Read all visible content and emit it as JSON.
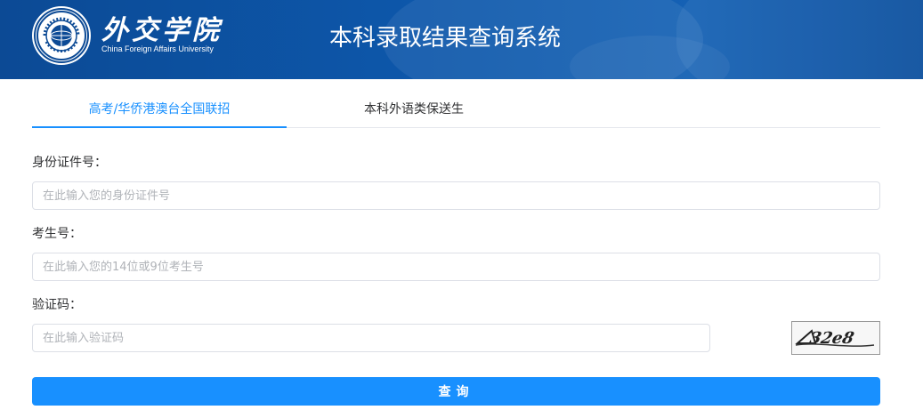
{
  "header": {
    "logo_cn": "外交学院",
    "logo_en": "China Foreign Affairs University",
    "system_title": "本科录取结果查询系统"
  },
  "tabs": [
    {
      "label": "高考/华侨港澳台全国联招",
      "active": true
    },
    {
      "label": "本科外语类保送生",
      "active": false
    }
  ],
  "form": {
    "id_label": "身份证件号：",
    "id_placeholder": "在此输入您的身份证件号",
    "exam_label": "考生号：",
    "exam_placeholder": "在此输入您的14位或9位考生号",
    "captcha_label": "验证码：",
    "captcha_placeholder": "在此输入验证码",
    "captcha_text": "32e8",
    "submit_label": "查询"
  },
  "colors": {
    "header_bg": "#0d57aa",
    "accent": "#1890ff"
  }
}
